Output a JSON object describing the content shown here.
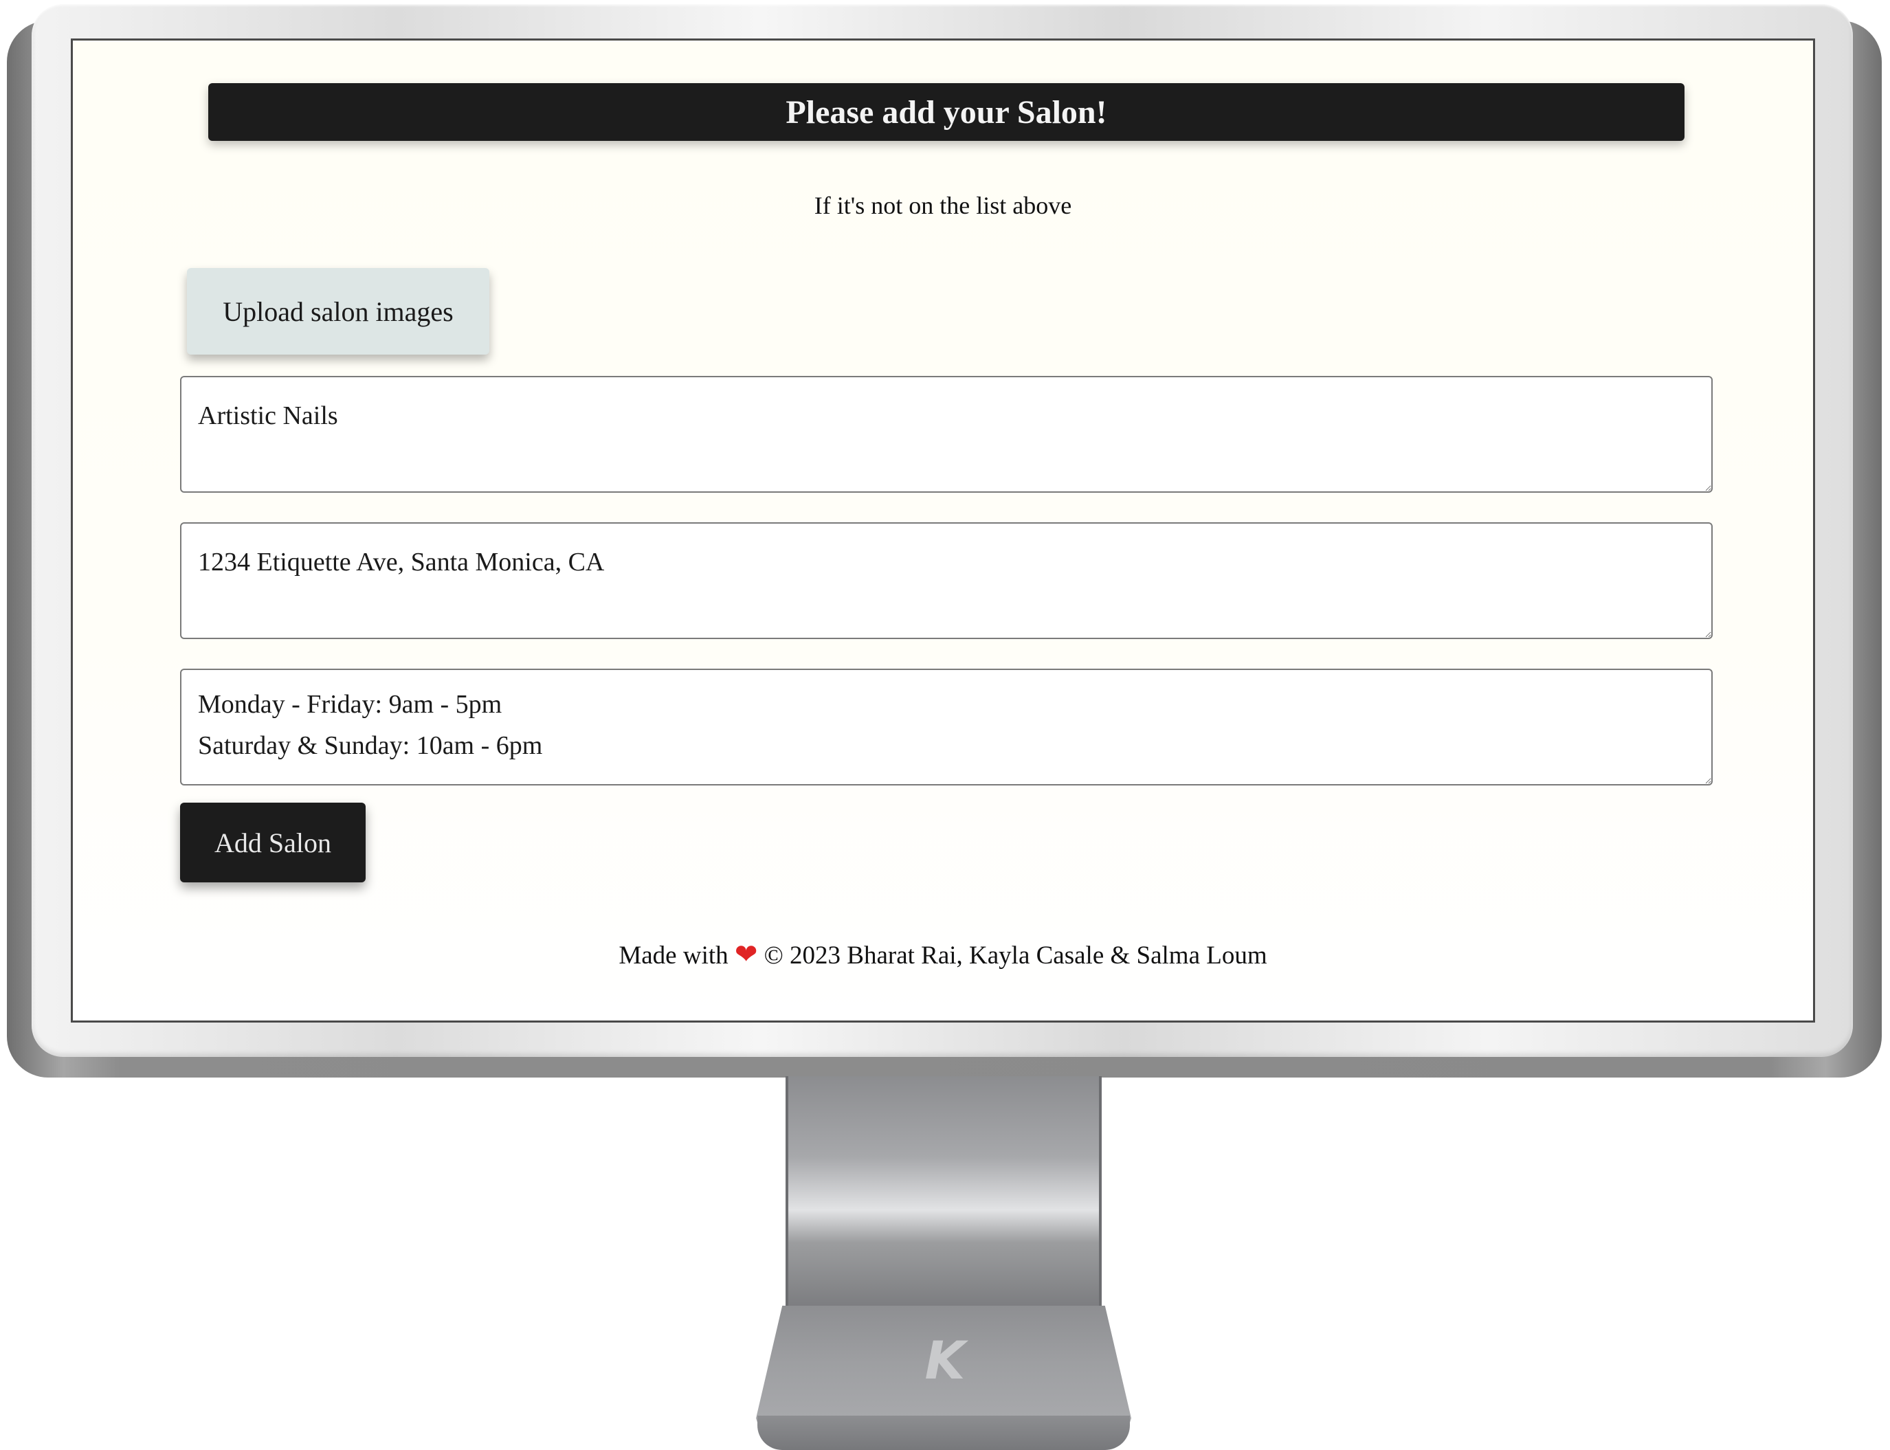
{
  "header": {
    "title": "Please add your Salon!"
  },
  "subtitle": "If it's not on the list above",
  "form": {
    "upload_label": "Upload salon images",
    "salon_name": "Artistic Nails",
    "address": "1234 Etiquette Ave, Santa Monica, CA",
    "hours": "Monday - Friday: 9am - 5pm\nSaturday & Sunday: 10am - 6pm",
    "submit_label": "Add Salon"
  },
  "footer": {
    "made_with": "Made with",
    "heart": "❤",
    "credits": "© 2023 Bharat Rai, Kayla Casale & Salma Loum"
  },
  "monitor": {
    "logo": "K"
  },
  "colors": {
    "banner": "#1c1c1c",
    "upload_button": "#dde6e5",
    "add_button": "#1c1c1c",
    "heart": "#e02424",
    "page_background": "#fffef6"
  }
}
